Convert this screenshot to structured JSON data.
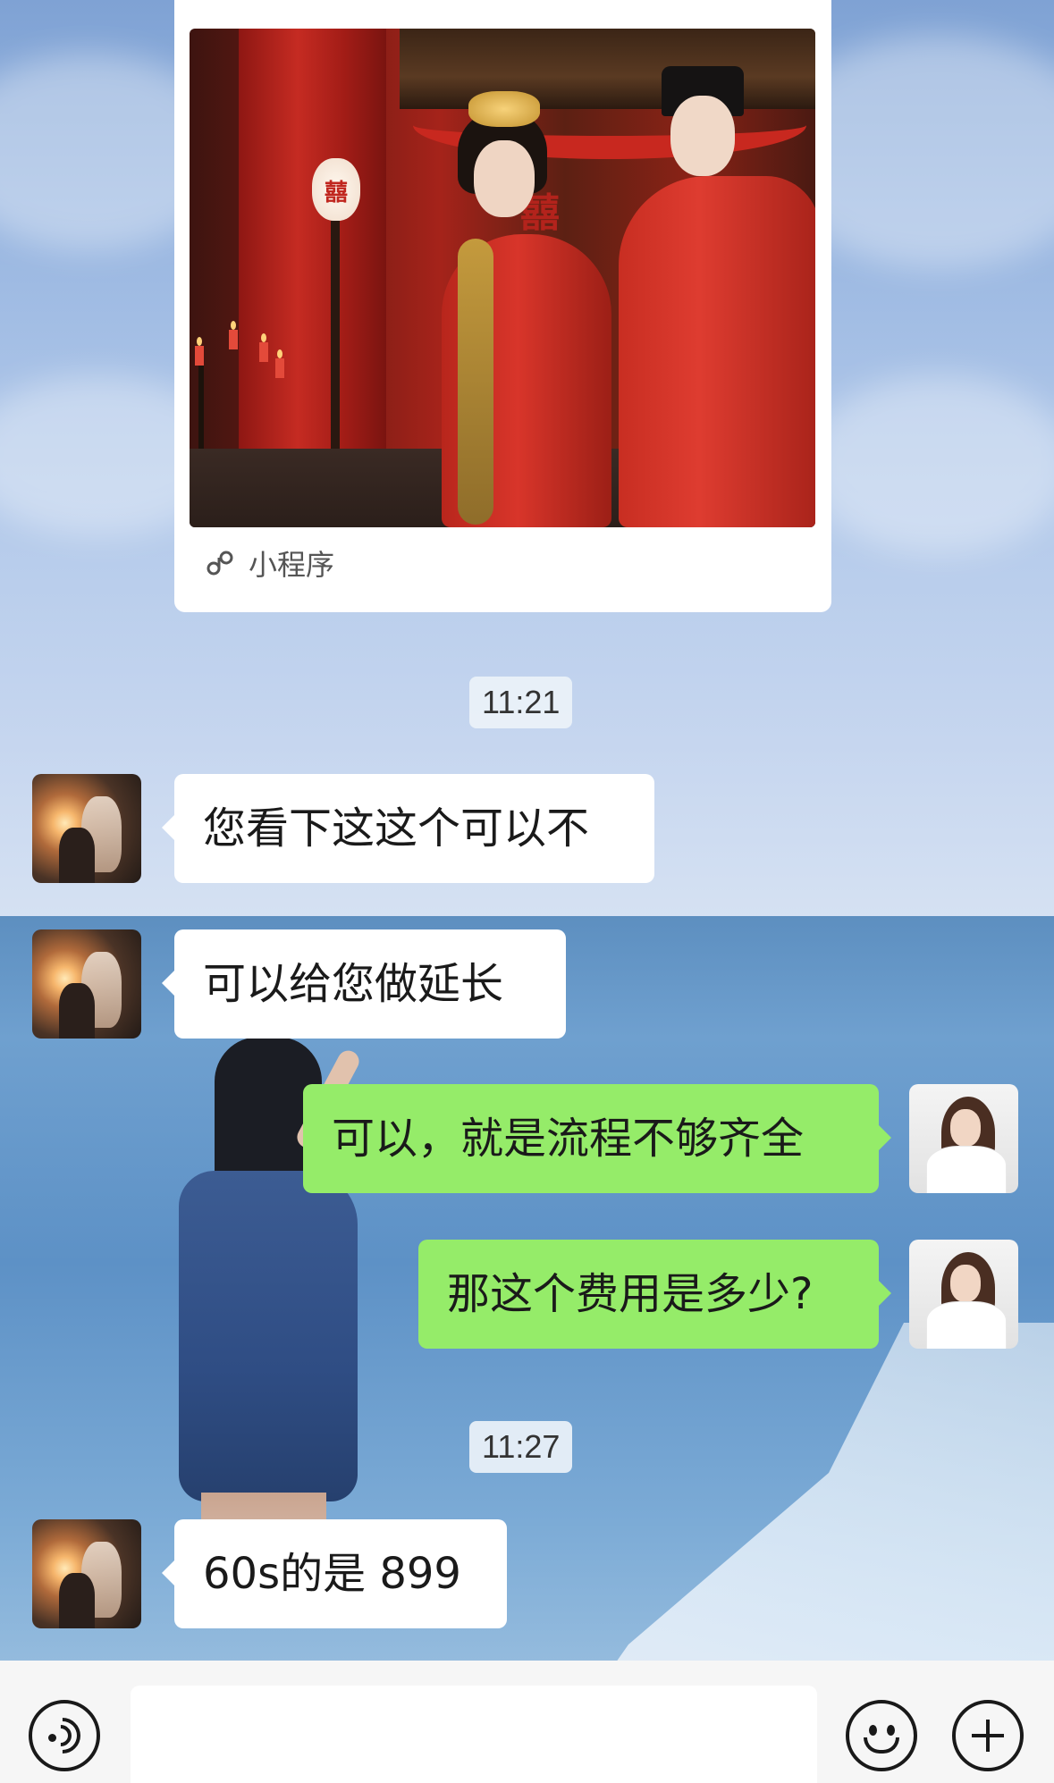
{
  "mini_program": {
    "label": "小程序",
    "image_chars": "囍"
  },
  "timestamps": [
    "11:21",
    "11:27"
  ],
  "messages": [
    {
      "side": "in",
      "text": "您看下这这个可以不"
    },
    {
      "side": "in",
      "text": "可以给您做延长"
    },
    {
      "side": "out",
      "text": "可以，就是流程不够齐全"
    },
    {
      "side": "out",
      "text": "那这个费用是多少?"
    },
    {
      "side": "in",
      "text": "60s的是 899"
    }
  ],
  "input_bar": {
    "voice_icon": "voice-icon",
    "emoji_icon": "emoji-icon",
    "plus_icon": "plus-icon",
    "placeholder": ""
  },
  "colors": {
    "bubble_out": "#95ec69",
    "bubble_in": "#ffffff",
    "bar": "#f6f6f6"
  }
}
